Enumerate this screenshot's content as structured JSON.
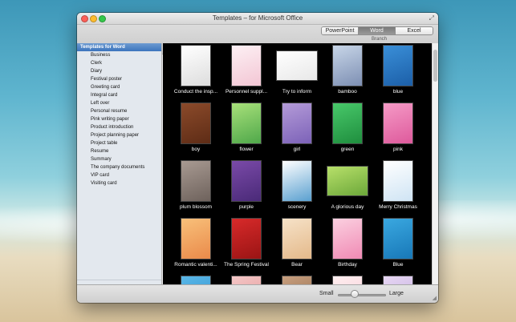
{
  "window": {
    "title": "Templates – for Microsoft Office"
  },
  "toolbar": {
    "segments": [
      "PowerPoint",
      "Word",
      "Excel"
    ],
    "selected": "Word",
    "caption": "Branch"
  },
  "sidebar": {
    "header": "Templates for Word",
    "items": [
      "Business",
      "Clerk",
      "Diary",
      "Festival poster",
      "Greeting card",
      "Integral card",
      "Left over",
      "Personal resume",
      "Pink writing paper",
      "Product introduction",
      "Project planning paper",
      "Project table",
      "Resume",
      "Summary",
      "The company documents",
      "VIP card",
      "Visiting card"
    ]
  },
  "templates": [
    {
      "label": "Conduct the insp...",
      "colors": [
        "#ffffff",
        "#dddddd"
      ],
      "wide": false
    },
    {
      "label": "Personnel suppl...",
      "colors": [
        "#fdf0f4",
        "#f3c6d4"
      ],
      "wide": false
    },
    {
      "label": "Try to inform",
      "colors": [
        "#ffffff",
        "#e8e8e8"
      ],
      "wide": true
    },
    {
      "label": "bamboo",
      "colors": [
        "#c8d6e8",
        "#7d8fb3"
      ],
      "wide": false
    },
    {
      "label": "blue",
      "colors": [
        "#3a8fd8",
        "#1c5fa8"
      ],
      "wide": false
    },
    {
      "label": "boy",
      "colors": [
        "#8b4a2a",
        "#5e2c16"
      ],
      "wide": false
    },
    {
      "label": "flower",
      "colors": [
        "#a8e07a",
        "#4fa84a"
      ],
      "wide": false
    },
    {
      "label": "girl",
      "colors": [
        "#b49bd8",
        "#7c62b8"
      ],
      "wide": false
    },
    {
      "label": "green",
      "colors": [
        "#48c86a",
        "#1f8e3e"
      ],
      "wide": false
    },
    {
      "label": "pink",
      "colors": [
        "#f59ac6",
        "#de5a9c"
      ],
      "wide": false
    },
    {
      "label": "plum blossom",
      "colors": [
        "#a89a92",
        "#6e625c"
      ],
      "wide": false
    },
    {
      "label": "purple",
      "colors": [
        "#7a4aa8",
        "#4a2a78"
      ],
      "wide": false
    },
    {
      "label": "scenery",
      "colors": [
        "#ffffff",
        "#5aa0d0"
      ],
      "wide": false
    },
    {
      "label": "A glorious day",
      "colors": [
        "#b8e06a",
        "#6ca83a"
      ],
      "wide": true
    },
    {
      "label": "Merry Christmas",
      "colors": [
        "#ffffff",
        "#cfe4f4"
      ],
      "wide": false
    },
    {
      "label": "Romantic valenti...",
      "colors": [
        "#f8c07a",
        "#ea8a4a"
      ],
      "wide": false
    },
    {
      "label": "The Spring Festival",
      "colors": [
        "#d82a2a",
        "#9a1414"
      ],
      "wide": false
    },
    {
      "label": "Bear",
      "colors": [
        "#f6e2c8",
        "#e4b98a"
      ],
      "wide": false
    },
    {
      "label": "Birthday",
      "colors": [
        "#fbd0e0",
        "#f08ab4"
      ],
      "wide": false
    },
    {
      "label": "Blue",
      "colors": [
        "#3aa8e0",
        "#1878b8"
      ],
      "wide": false
    },
    {
      "label": "",
      "colors": [
        "#5ab8e8",
        "#2a88c8"
      ],
      "wide": false
    },
    {
      "label": "",
      "colors": [
        "#f4c8c8",
        "#e08a8a"
      ],
      "wide": false
    },
    {
      "label": "",
      "colors": [
        "#c8a080",
        "#8a6040"
      ],
      "wide": false
    },
    {
      "label": "",
      "colors": [
        "#fff0f0",
        "#f4c0d0"
      ],
      "wide": false
    },
    {
      "label": "",
      "colors": [
        "#e8d8f4",
        "#b8a0d8"
      ],
      "wide": false
    }
  ],
  "bottom": {
    "small_label": "Small",
    "large_label": "Large",
    "size_level": 0.35
  },
  "colors": {
    "grid_bg": "#000000",
    "selection": "#3c74bd"
  }
}
